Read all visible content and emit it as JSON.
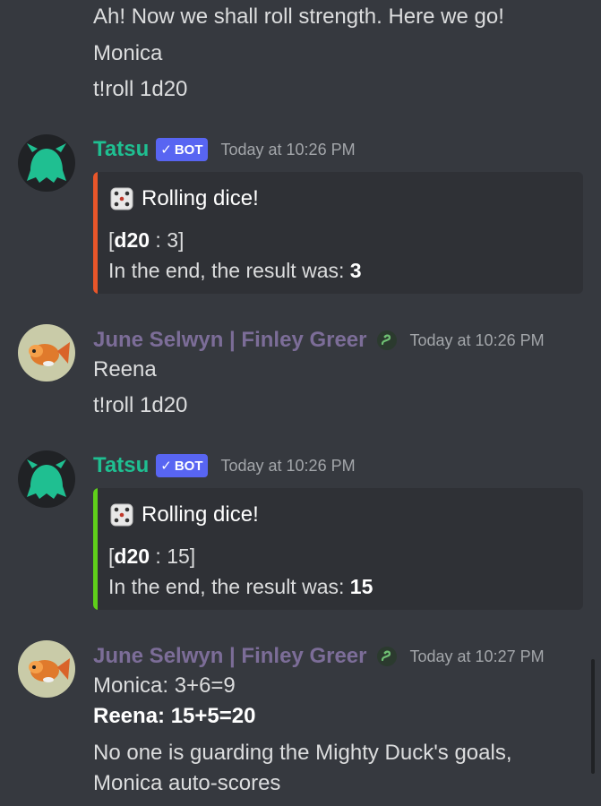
{
  "prev_messages": [
    "Ah! Now we shall roll strength. Here we go!",
    "Monica",
    "t!roll 1d20"
  ],
  "bot": {
    "name": "Tatsu",
    "tag_check": "✓",
    "tag": "BOT",
    "name_color": "#1fbf91"
  },
  "bot_msg_1": {
    "timestamp": "Today at 10:26 PM",
    "embed_color": "#e8562a",
    "title": "Rolling dice!",
    "roll_open": "[",
    "roll_die": "d20",
    "roll_sep": " : ",
    "roll_value": "3",
    "roll_close": "]",
    "result_prefix": "In the end, the result was: ",
    "result_value": "3"
  },
  "user_msg_1": {
    "username": "June Selwyn | Finley Greer",
    "badge_icon": "snake-crest-icon",
    "timestamp": "Today at 10:26 PM",
    "lines": [
      "Reena",
      "t!roll 1d20"
    ]
  },
  "bot_msg_2": {
    "timestamp": "Today at 10:26 PM",
    "embed_color": "#5fcf1a",
    "title": "Rolling dice!",
    "roll_open": "[",
    "roll_die": "d20",
    "roll_sep": " : ",
    "roll_value": "15",
    "roll_close": "]",
    "result_prefix": "In the end, the result was: ",
    "result_value": "15"
  },
  "user_msg_2": {
    "username": "June Selwyn | Finley Greer",
    "badge_icon": "snake-crest-icon",
    "timestamp": "Today at 10:27 PM",
    "line1": "Monica: 3+6=9",
    "line2_bold": "Reena: 15+5=20",
    "line3": "No one is guarding the Mighty Duck's goals,",
    "line4": "Monica auto-scores"
  },
  "colors": {
    "background": "#36393f",
    "embed_bg": "#2f3136",
    "bot_tag": "#5865f2",
    "username_user": "#7c6d98",
    "timestamp": "#a3a6aa"
  }
}
